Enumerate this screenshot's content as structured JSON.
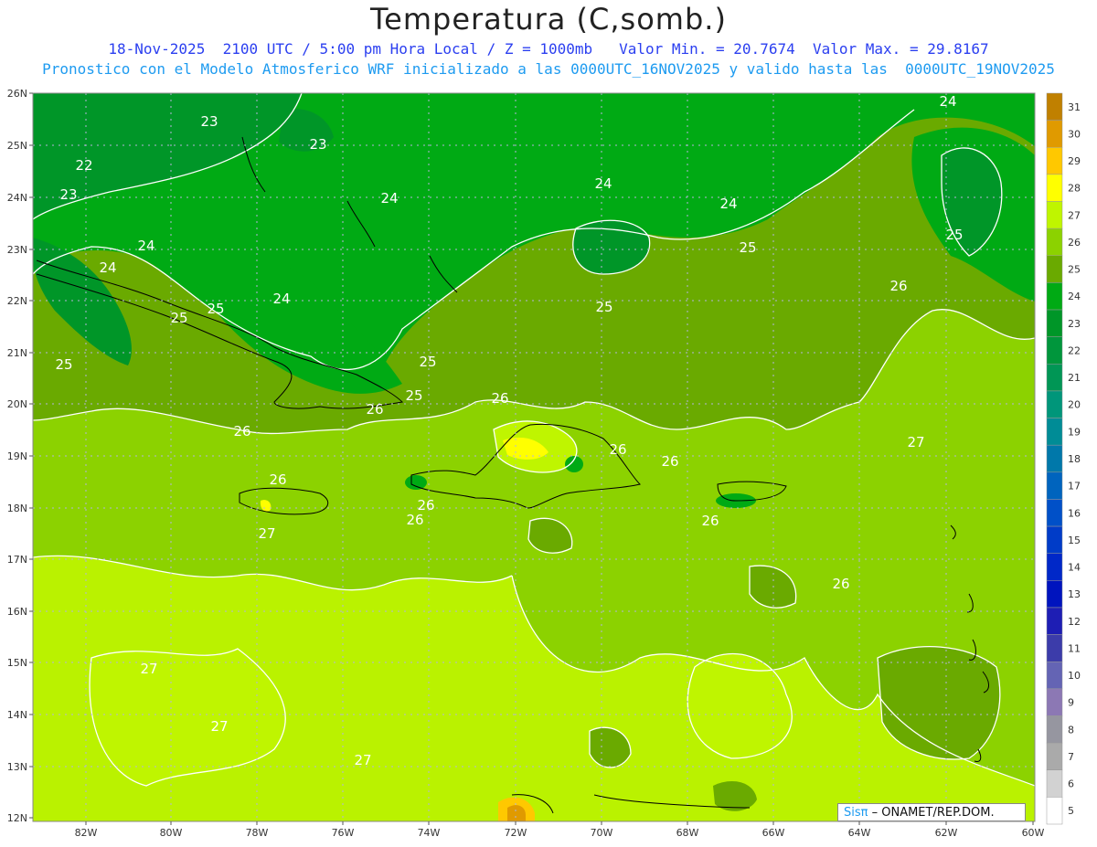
{
  "title": "Temperatura (C,somb.)",
  "subtitle_line1": "18-Nov-2025  2100 UTC / 5:00 pm Hora Local / Z = 1000mb   Valor Min. = 20.7674  Valor Max. = 29.8167",
  "subtitle_line2": "Pronostico con el Modelo Atmosferico WRF inicializado a las 0000UTC_16NOV2025 y valido hasta las  0000UTC_19NOV2025",
  "lat_labels": [
    "26N",
    "25N",
    "24N",
    "23N",
    "22N",
    "21N",
    "20N",
    "19N",
    "18N",
    "17N",
    "16N",
    "15N",
    "14N",
    "13N",
    "12N"
  ],
  "lon_labels": [
    "82W",
    "80W",
    "78W",
    "76W",
    "74W",
    "72W",
    "70W",
    "68W",
    "66W",
    "64W",
    "62W",
    "60W"
  ],
  "colorbar": [
    {
      "value": "31",
      "color": "#c08000"
    },
    {
      "value": "30",
      "color": "#e09a00"
    },
    {
      "value": "29",
      "color": "#ffc800"
    },
    {
      "value": "28",
      "color": "#ffff00"
    },
    {
      "value": "27",
      "color": "#bff500"
    },
    {
      "value": "26",
      "color": "#8cd200"
    },
    {
      "value": "25",
      "color": "#6aaa00"
    },
    {
      "value": "24",
      "color": "#00aa14"
    },
    {
      "value": "23",
      "color": "#009628"
    },
    {
      "value": "22",
      "color": "#00963c"
    },
    {
      "value": "21",
      "color": "#009655"
    },
    {
      "value": "20",
      "color": "#00967a"
    },
    {
      "value": "19",
      "color": "#008c96"
    },
    {
      "value": "18",
      "color": "#0078aa"
    },
    {
      "value": "17",
      "color": "#0064be"
    },
    {
      "value": "16",
      "color": "#0050c8"
    },
    {
      "value": "15",
      "color": "#003cc8"
    },
    {
      "value": "14",
      "color": "#0028c8"
    },
    {
      "value": "13",
      "color": "#0014be"
    },
    {
      "value": "12",
      "color": "#1e1eb4"
    },
    {
      "value": "11",
      "color": "#3c3caa"
    },
    {
      "value": "10",
      "color": "#6464b4"
    },
    {
      "value": "9",
      "color": "#8c78b4"
    },
    {
      "value": "8",
      "color": "#9696a0"
    },
    {
      "value": "7",
      "color": "#aaaaaa"
    },
    {
      "value": "6",
      "color": "#d2d2d2"
    },
    {
      "value": "5",
      "color": "#ffffff"
    }
  ],
  "contour_labels": [
    "22",
    "23",
    "23",
    "23",
    "24",
    "24",
    "24",
    "24",
    "24",
    "24",
    "24",
    "25",
    "25",
    "25",
    "25",
    "25",
    "25",
    "25",
    "25",
    "26",
    "26",
    "26",
    "26",
    "26",
    "26",
    "26",
    "26",
    "26",
    "26",
    "26",
    "27",
    "27",
    "27",
    "27",
    "27"
  ],
  "credit": {
    "brand": "Sisπ",
    "text": "– ONAMET/REP.DOM."
  },
  "colors": {
    "grid": "#b4b4dc",
    "coast": "#000000",
    "contour": "#ffffff"
  }
}
